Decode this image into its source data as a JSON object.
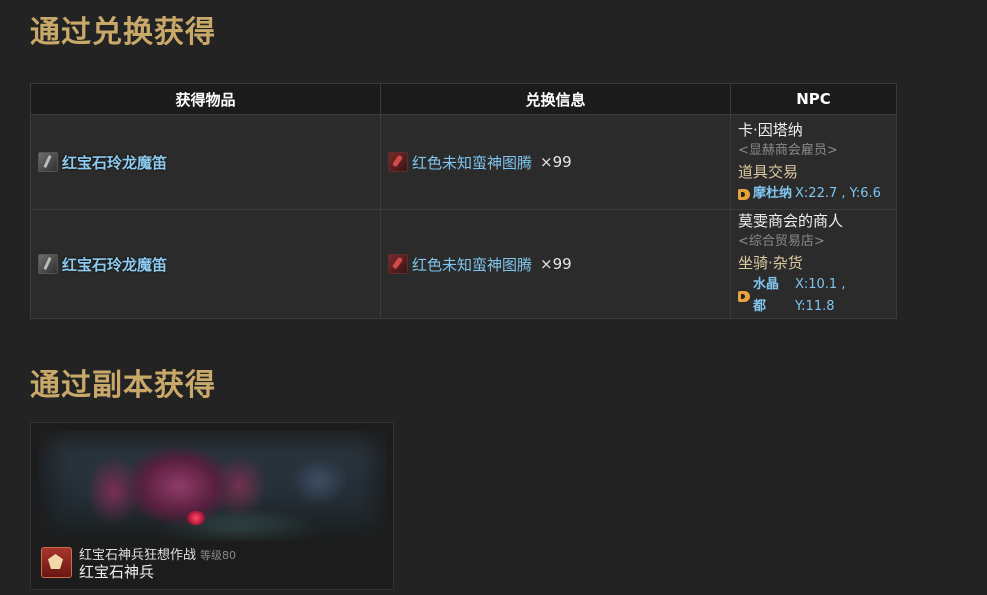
{
  "sections": {
    "exchange_title": "通过兑换获得",
    "dungeon_title": "通过副本获得"
  },
  "table": {
    "headers": {
      "item": "获得物品",
      "exchange": "兑换信息",
      "npc": "NPC"
    },
    "rows": [
      {
        "item": "红宝石玲龙魔笛",
        "item_icon": "flute-icon",
        "cost_item": "红色未知蛮神图腾",
        "cost_qty": "×99",
        "cost_icon": "totem-icon",
        "npc_name": "卡·因塔纳",
        "npc_title": "<显赫商会雇员>",
        "npc_shop": "道具交易",
        "location_place": "摩杜纳",
        "location_coords": " X:22.7 , Y:6.6"
      },
      {
        "item": "红宝石玲龙魔笛",
        "item_icon": "flute-icon",
        "cost_item": "红色未知蛮神图腾",
        "cost_qty": "×99",
        "cost_icon": "totem-icon",
        "npc_name": "莫雯商会的商人",
        "npc_title": "<综合贸易店>",
        "npc_shop": "坐骑·杂货",
        "location_place": "水晶都",
        "location_coords": " X:10.1 , Y:11.8"
      }
    ]
  },
  "duty": {
    "name": "红宝石神兵狂想作战",
    "level": "等级80",
    "boss": "红宝石神兵",
    "icon": "trial-icon"
  },
  "colors": {
    "background": "#232323",
    "section_title": "#c8a96a",
    "link": "#8ecbf1",
    "map_marker": "#e8a23c"
  }
}
